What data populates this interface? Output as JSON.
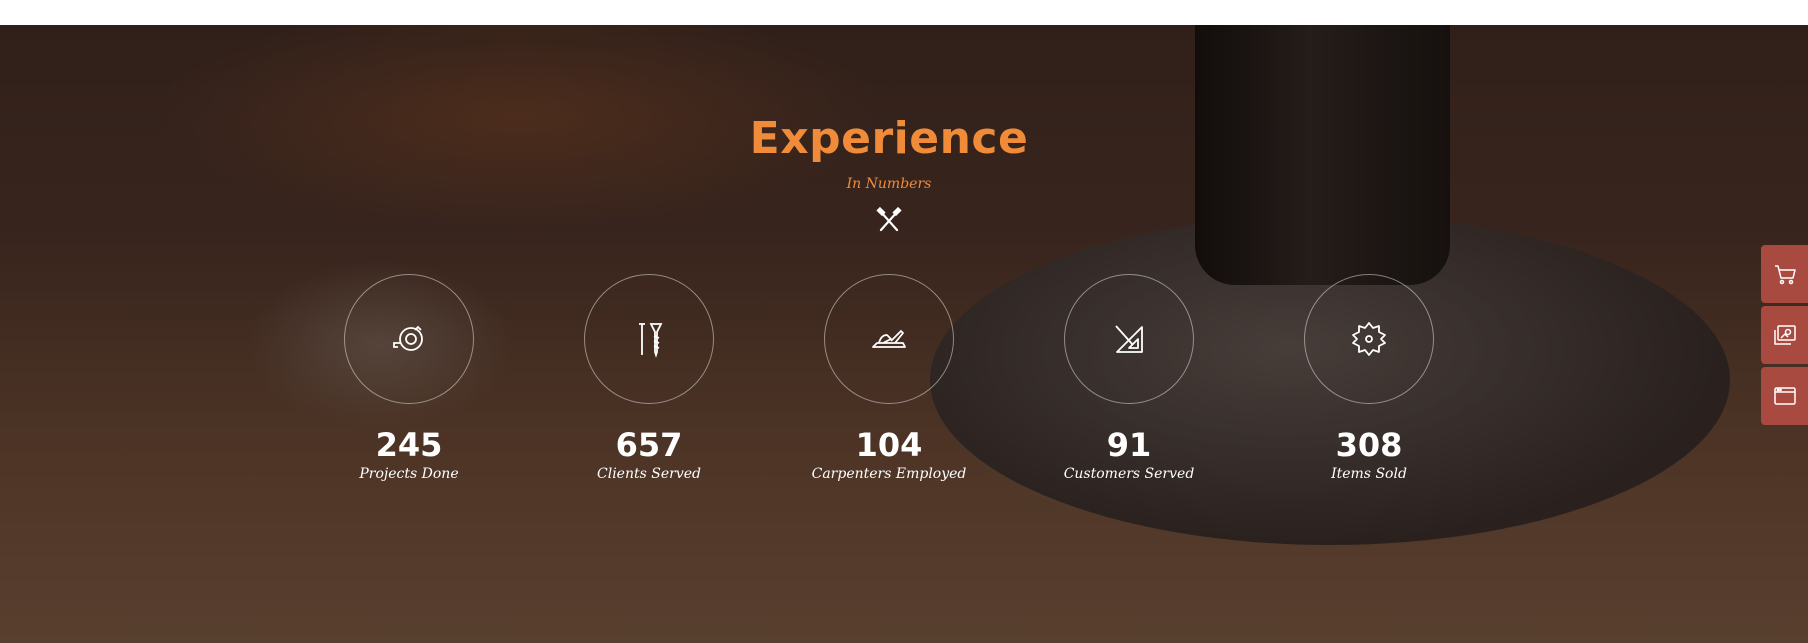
{
  "section": {
    "title": "Experience",
    "subtitle": "In Numbers",
    "divider_icon": "crossed-hammers-icon"
  },
  "stats": [
    {
      "icon": "tape-measure-icon",
      "value": "245",
      "label": "Projects Done"
    },
    {
      "icon": "nail-screw-icon",
      "value": "657",
      "label": "Clients Served"
    },
    {
      "icon": "hand-plane-icon",
      "value": "104",
      "label": "Carpenters Employed"
    },
    {
      "icon": "set-square-icon",
      "value": "91",
      "label": "Customers Served"
    },
    {
      "icon": "saw-blade-icon",
      "value": "308",
      "label": "Items Sold"
    }
  ],
  "sidebar": [
    {
      "icon": "cart-icon"
    },
    {
      "icon": "gallery-icon"
    },
    {
      "icon": "browser-window-icon"
    }
  ],
  "colors": {
    "accent": "#f08b3a",
    "sidebar": "#a84a3f",
    "text": "#ffffff"
  }
}
